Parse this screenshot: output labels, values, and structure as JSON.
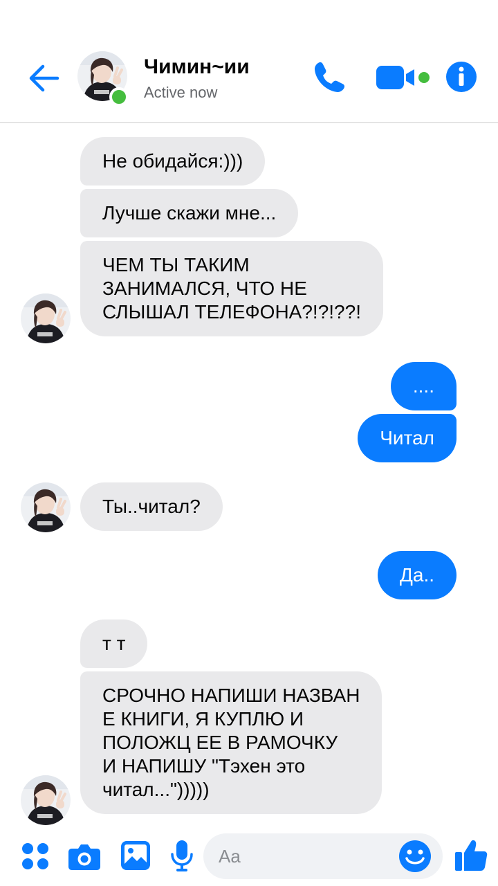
{
  "header": {
    "contact_name": "Чимин~ии",
    "status": "Active now"
  },
  "messages": [
    {
      "side": "in",
      "text": "Не обидайся:)))"
    },
    {
      "side": "in",
      "text": "Лучше скажи мне..."
    },
    {
      "side": "in",
      "text": "ЧЕМ ТЫ ТАКИМ\nЗАНИМАЛСЯ, ЧТО НЕ\nСЛЫШАЛ ТЕЛЕФОНА?!?!??!"
    },
    {
      "side": "out",
      "text": "...."
    },
    {
      "side": "out",
      "text": "Читал"
    },
    {
      "side": "in",
      "text": "Ты..читал?"
    },
    {
      "side": "out",
      "text": "Да.."
    },
    {
      "side": "in",
      "text": "т т"
    },
    {
      "side": "in",
      "text": "СРОЧНО НАПИШИ НАЗВАН\nЕ КНИГИ, Я КУПЛЮ И\nПОЛОЖЦ ЕЕ В РАМОЧКУ\nИ НАПИШУ \"Тэхен это\nчитал...\")))))"
    }
  ],
  "composer": {
    "placeholder": "Aa"
  },
  "icons": {
    "back": "back-arrow-icon",
    "call": "phone-icon",
    "video": "video-camera-icon",
    "info": "info-icon",
    "apps": "apps-grid-icon",
    "camera": "camera-icon",
    "gallery": "gallery-icon",
    "mic": "microphone-icon",
    "emoji": "emoji-icon",
    "like": "thumbs-up-icon"
  },
  "colors": {
    "accent": "#0a7cff",
    "incoming_bubble": "#e9e9eb",
    "online": "#45bd3e"
  }
}
